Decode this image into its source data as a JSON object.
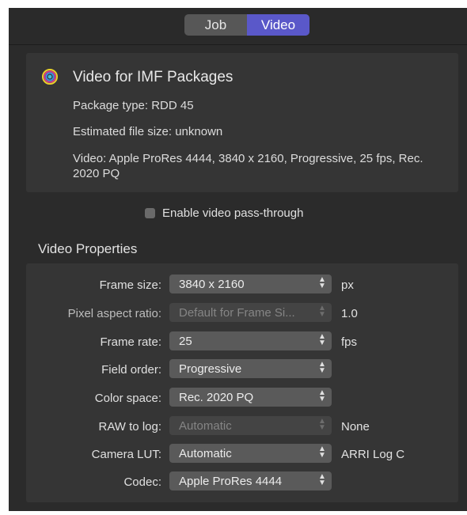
{
  "tabs": [
    {
      "label": "Job",
      "active": false
    },
    {
      "label": "Video",
      "active": true
    }
  ],
  "info": {
    "icon": "compressor-setting-icon",
    "title": "Video for IMF Packages",
    "package_type": "Package type: RDD 45",
    "file_size": "Estimated file size: unknown",
    "video_summary": "Video: Apple ProRes 4444, 3840 x 2160, Progressive, 25 fps, Rec. 2020 PQ"
  },
  "passthrough": {
    "label": "Enable video pass-through",
    "checked": false
  },
  "section_title": "Video Properties",
  "properties": [
    {
      "label": "Frame size:",
      "value": "3840 x 2160",
      "suffix": "px",
      "enabled": true
    },
    {
      "label": "Pixel aspect ratio:",
      "value": "Default for Frame Si...",
      "suffix": "1.0",
      "enabled": false
    },
    {
      "label": "Frame rate:",
      "value": "25",
      "suffix": "fps",
      "enabled": true
    },
    {
      "label": "Field order:",
      "value": "Progressive",
      "suffix": "",
      "enabled": true
    },
    {
      "label": "Color space:",
      "value": "Rec. 2020 PQ",
      "suffix": "",
      "enabled": true
    },
    {
      "label": "RAW to log:",
      "value": "Automatic",
      "suffix": "None",
      "enabled": false
    },
    {
      "label": "Camera LUT:",
      "value": "Automatic",
      "suffix": "ARRI Log C",
      "enabled": true
    },
    {
      "label": "Codec:",
      "value": "Apple ProRes 4444",
      "suffix": "",
      "enabled": true
    }
  ],
  "colors": {
    "accent": "#5a58c9",
    "panel": "#2b2b2b",
    "box": "#353535"
  }
}
